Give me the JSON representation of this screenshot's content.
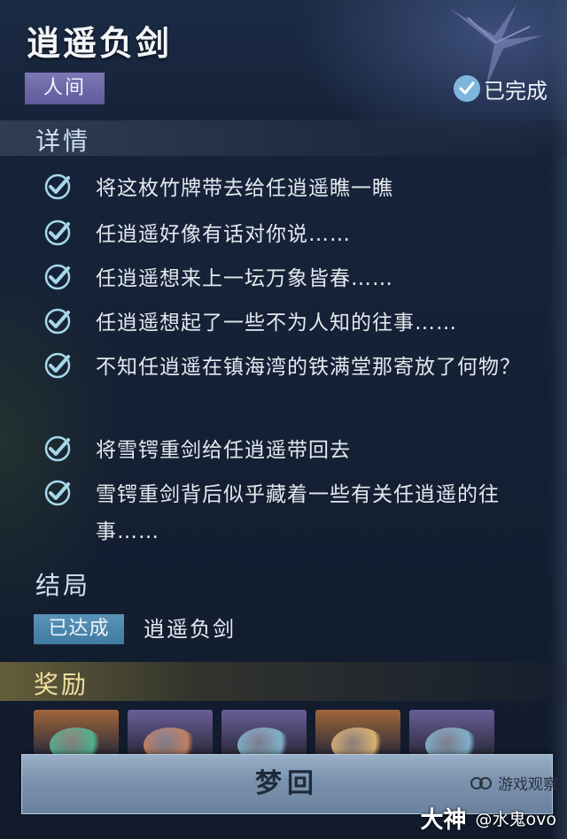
{
  "header": {
    "title": "逍遥负剑",
    "world_tag": "人间",
    "status": "已完成"
  },
  "details": {
    "heading": "详情",
    "tasks": [
      {
        "text": "将这枚竹牌带去给任逍遥瞧一瞧",
        "done": true
      },
      {
        "text": "任逍遥好像有话对你说……",
        "done": true
      },
      {
        "text": "任逍遥想来上一坛万象皆春……",
        "done": true
      },
      {
        "text": "任逍遥想起了一些不为人知的往事……",
        "done": true
      },
      {
        "text": "不知任逍遥在镇海湾的铁满堂那寄放了何物？",
        "done": true
      },
      {
        "text": "将雪锷重剑给任逍遥带回去",
        "done": true
      },
      {
        "text": "雪锷重剑背后似乎藏着一些有关任逍遥的往事……",
        "done": true
      }
    ]
  },
  "ending": {
    "heading": "结局",
    "badge": "已达成",
    "name": "逍遥负剑"
  },
  "rewards": {
    "heading": "奖励",
    "slots": [
      {
        "icon": "jade-ring-icon",
        "frame_color": "#a0673a"
      },
      {
        "icon": "weapon-icon",
        "frame_color": "#6a5e98"
      },
      {
        "icon": "jade-ornament-icon",
        "frame_color": "#6a5e98"
      },
      {
        "icon": "map-scroll-icon",
        "frame_color": "#a0673a"
      },
      {
        "icon": "jade-ornament-icon",
        "frame_color": "#6a5e98"
      }
    ]
  },
  "actions": {
    "dream_button": "梦回"
  },
  "watermark": {
    "channel": "游戏观察",
    "brand": "大神",
    "user": "@水鬼ovo"
  },
  "colors": {
    "check": "#a6d7ea",
    "accent_blue": "#4a86ad",
    "reward_gold": "#f1dfa2"
  }
}
